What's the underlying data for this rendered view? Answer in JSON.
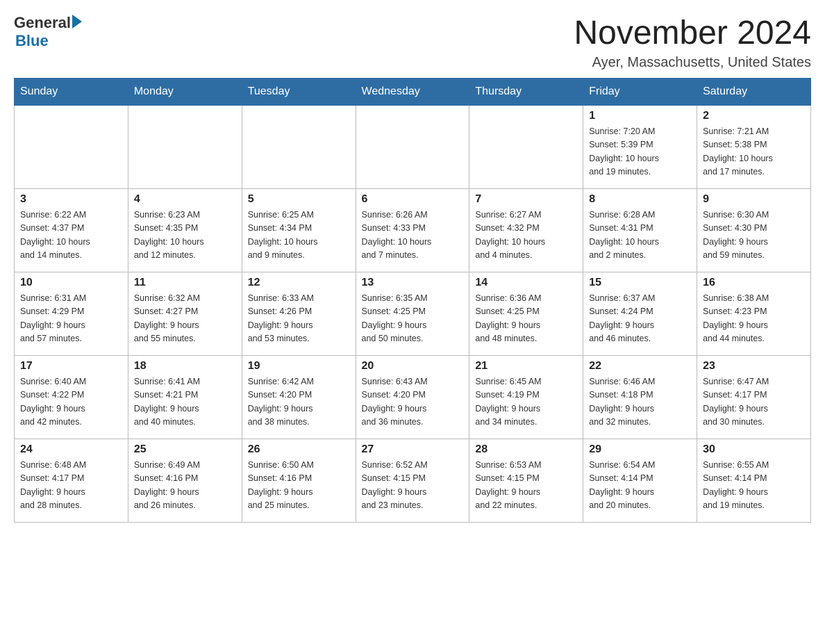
{
  "logo": {
    "general": "General",
    "blue": "Blue",
    "arrow": "▶"
  },
  "title": "November 2024",
  "subtitle": "Ayer, Massachusetts, United States",
  "weekdays": [
    "Sunday",
    "Monday",
    "Tuesday",
    "Wednesday",
    "Thursday",
    "Friday",
    "Saturday"
  ],
  "weeks": [
    [
      {
        "day": "",
        "info": ""
      },
      {
        "day": "",
        "info": ""
      },
      {
        "day": "",
        "info": ""
      },
      {
        "day": "",
        "info": ""
      },
      {
        "day": "",
        "info": ""
      },
      {
        "day": "1",
        "info": "Sunrise: 7:20 AM\nSunset: 5:39 PM\nDaylight: 10 hours\nand 19 minutes."
      },
      {
        "day": "2",
        "info": "Sunrise: 7:21 AM\nSunset: 5:38 PM\nDaylight: 10 hours\nand 17 minutes."
      }
    ],
    [
      {
        "day": "3",
        "info": "Sunrise: 6:22 AM\nSunset: 4:37 PM\nDaylight: 10 hours\nand 14 minutes."
      },
      {
        "day": "4",
        "info": "Sunrise: 6:23 AM\nSunset: 4:35 PM\nDaylight: 10 hours\nand 12 minutes."
      },
      {
        "day": "5",
        "info": "Sunrise: 6:25 AM\nSunset: 4:34 PM\nDaylight: 10 hours\nand 9 minutes."
      },
      {
        "day": "6",
        "info": "Sunrise: 6:26 AM\nSunset: 4:33 PM\nDaylight: 10 hours\nand 7 minutes."
      },
      {
        "day": "7",
        "info": "Sunrise: 6:27 AM\nSunset: 4:32 PM\nDaylight: 10 hours\nand 4 minutes."
      },
      {
        "day": "8",
        "info": "Sunrise: 6:28 AM\nSunset: 4:31 PM\nDaylight: 10 hours\nand 2 minutes."
      },
      {
        "day": "9",
        "info": "Sunrise: 6:30 AM\nSunset: 4:30 PM\nDaylight: 9 hours\nand 59 minutes."
      }
    ],
    [
      {
        "day": "10",
        "info": "Sunrise: 6:31 AM\nSunset: 4:29 PM\nDaylight: 9 hours\nand 57 minutes."
      },
      {
        "day": "11",
        "info": "Sunrise: 6:32 AM\nSunset: 4:27 PM\nDaylight: 9 hours\nand 55 minutes."
      },
      {
        "day": "12",
        "info": "Sunrise: 6:33 AM\nSunset: 4:26 PM\nDaylight: 9 hours\nand 53 minutes."
      },
      {
        "day": "13",
        "info": "Sunrise: 6:35 AM\nSunset: 4:25 PM\nDaylight: 9 hours\nand 50 minutes."
      },
      {
        "day": "14",
        "info": "Sunrise: 6:36 AM\nSunset: 4:25 PM\nDaylight: 9 hours\nand 48 minutes."
      },
      {
        "day": "15",
        "info": "Sunrise: 6:37 AM\nSunset: 4:24 PM\nDaylight: 9 hours\nand 46 minutes."
      },
      {
        "day": "16",
        "info": "Sunrise: 6:38 AM\nSunset: 4:23 PM\nDaylight: 9 hours\nand 44 minutes."
      }
    ],
    [
      {
        "day": "17",
        "info": "Sunrise: 6:40 AM\nSunset: 4:22 PM\nDaylight: 9 hours\nand 42 minutes."
      },
      {
        "day": "18",
        "info": "Sunrise: 6:41 AM\nSunset: 4:21 PM\nDaylight: 9 hours\nand 40 minutes."
      },
      {
        "day": "19",
        "info": "Sunrise: 6:42 AM\nSunset: 4:20 PM\nDaylight: 9 hours\nand 38 minutes."
      },
      {
        "day": "20",
        "info": "Sunrise: 6:43 AM\nSunset: 4:20 PM\nDaylight: 9 hours\nand 36 minutes."
      },
      {
        "day": "21",
        "info": "Sunrise: 6:45 AM\nSunset: 4:19 PM\nDaylight: 9 hours\nand 34 minutes."
      },
      {
        "day": "22",
        "info": "Sunrise: 6:46 AM\nSunset: 4:18 PM\nDaylight: 9 hours\nand 32 minutes."
      },
      {
        "day": "23",
        "info": "Sunrise: 6:47 AM\nSunset: 4:17 PM\nDaylight: 9 hours\nand 30 minutes."
      }
    ],
    [
      {
        "day": "24",
        "info": "Sunrise: 6:48 AM\nSunset: 4:17 PM\nDaylight: 9 hours\nand 28 minutes."
      },
      {
        "day": "25",
        "info": "Sunrise: 6:49 AM\nSunset: 4:16 PM\nDaylight: 9 hours\nand 26 minutes."
      },
      {
        "day": "26",
        "info": "Sunrise: 6:50 AM\nSunset: 4:16 PM\nDaylight: 9 hours\nand 25 minutes."
      },
      {
        "day": "27",
        "info": "Sunrise: 6:52 AM\nSunset: 4:15 PM\nDaylight: 9 hours\nand 23 minutes."
      },
      {
        "day": "28",
        "info": "Sunrise: 6:53 AM\nSunset: 4:15 PM\nDaylight: 9 hours\nand 22 minutes."
      },
      {
        "day": "29",
        "info": "Sunrise: 6:54 AM\nSunset: 4:14 PM\nDaylight: 9 hours\nand 20 minutes."
      },
      {
        "day": "30",
        "info": "Sunrise: 6:55 AM\nSunset: 4:14 PM\nDaylight: 9 hours\nand 19 minutes."
      }
    ]
  ]
}
